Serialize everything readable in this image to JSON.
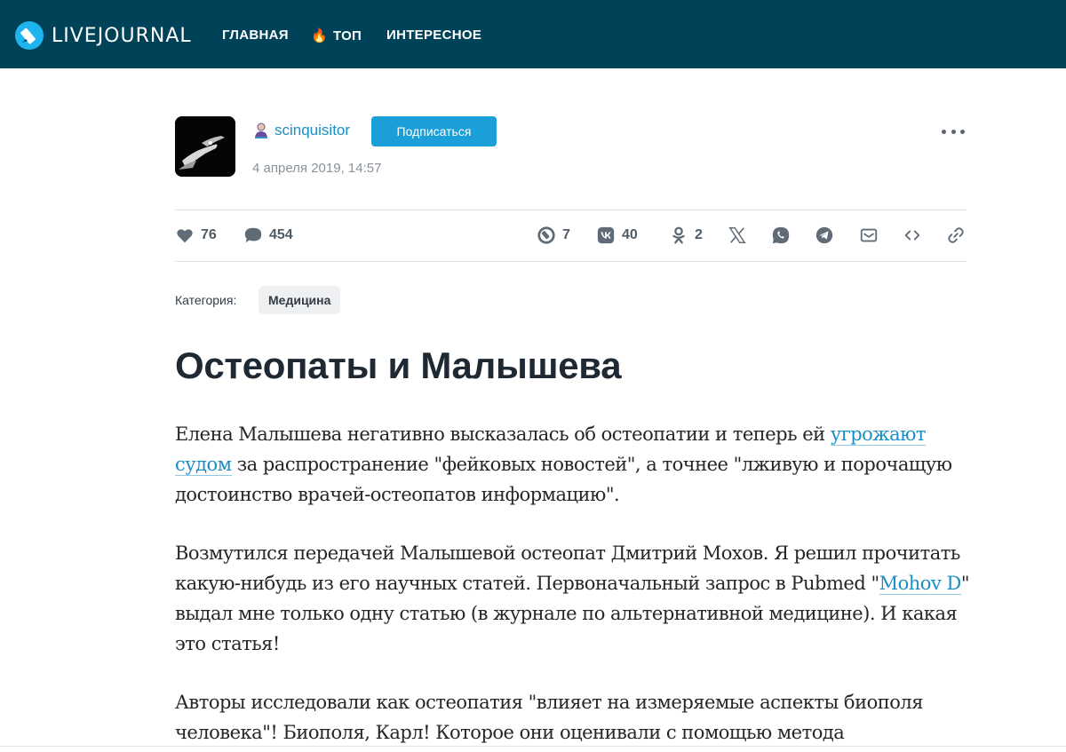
{
  "header": {
    "logo_text": "LIVEJOURNAL",
    "nav": {
      "home": "ГЛАВНАЯ",
      "top": "ТОП",
      "interesting": "ИНТЕРЕСНОЕ"
    },
    "background": "#004359"
  },
  "author": {
    "name": "scinquisitor",
    "subscribe_label": "Подписаться",
    "date": "4 апреля 2019, 14:57",
    "icon": "user-icon",
    "accent": "#1a9fd8"
  },
  "stats": {
    "likes": "76",
    "comments": "454",
    "livejournal_shares": "7",
    "vk_shares": "40",
    "ok_shares": "2"
  },
  "share_icons": [
    "repost-icon",
    "vk-icon",
    "odnoklassniki-icon",
    "x-icon",
    "whatsapp-icon",
    "telegram-icon",
    "email-icon",
    "embed-icon",
    "link-icon"
  ],
  "category": {
    "label": "Категория:",
    "value": "Медицина"
  },
  "post": {
    "title": "Остеопаты и Малышева",
    "p1": {
      "part1": "Елена Малышева негативно высказалась об остеопатии и теперь ей ",
      "link": "угрожают судом",
      "part2": " за распространение \"фейковых новостей\", а точнее \"лживую и порочащую достоинство врачей-остеопатов информацию\"."
    },
    "p2": {
      "part1": "Возмутился передачей Малышевой остеопат Дмитрий Мохов. Я решил прочитать какую-нибудь из его научных статей. Первоначальный запрос в Pubmed \"",
      "link": "Mohov D",
      "part2": "\" выдал мне только одну статью (в журнале по альтернативной медицине). И какая это статья!"
    },
    "p3": "Авторы исследовали как остеопатия \"влияет на измеряемые аспекты биополя человека\"! Биополя, Карл! Которое они оценивали с помощью метода"
  }
}
